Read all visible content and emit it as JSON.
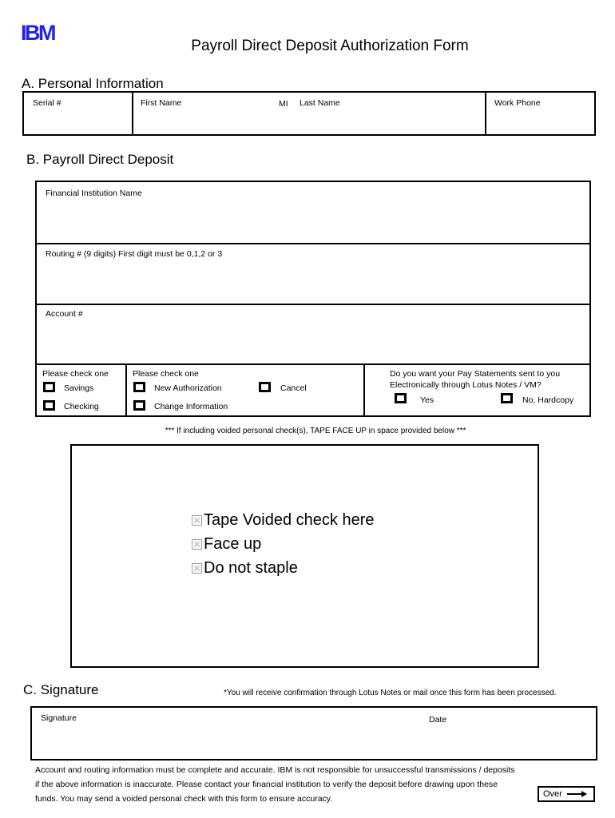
{
  "logo": {
    "text": "IBM",
    "color": "#2222ee"
  },
  "title": "Payroll Direct Deposit Authorization Form",
  "section_a": {
    "heading": "A. Personal Information",
    "fields": {
      "serial": "Serial #",
      "first_name": "First Name",
      "mi": "MI",
      "last_name": "Last Name",
      "work_phone": "Work Phone"
    }
  },
  "section_b": {
    "heading": "B. Payroll Direct Deposit",
    "fields": {
      "institution": "Financial Institution Name",
      "routing": "Routing # (9 digits) First digit must be 0,1,2 or 3",
      "account": "Account #"
    },
    "account_type": {
      "prompt": "Please check one",
      "options": [
        "Savings",
        "Checking"
      ]
    },
    "action_type": {
      "prompt": "Please check one",
      "options": [
        "New Authorization",
        "Cancel",
        "Change Information"
      ]
    },
    "pay_statements": {
      "prompt_line1": "Do you want your Pay Statements sent to you",
      "prompt_line2": "Electronically through Lotus Notes / VM?",
      "options": [
        "Yes",
        "No, Hardcopy"
      ]
    }
  },
  "tape_section": {
    "note": "*** If including voided personal check(s), TAPE FACE UP in space provided below ***",
    "items": [
      "Tape Voided check here",
      "Face up",
      "Do not staple"
    ],
    "bullet_icon": "broken-image-icon"
  },
  "section_c": {
    "heading": "C. Signature",
    "note": "*You will receive confirmation through Lotus Notes or mail once this form has been processed.",
    "fields": {
      "signature": "Signature",
      "date": "Date"
    }
  },
  "disclaimer": {
    "line1": "Account and routing information must be complete and accurate. IBM is not responsible for unsuccessful transmissions / deposits",
    "line2": "if the above information is inaccurate. Please contact your financial institution to verify the deposit before drawing upon these",
    "line3": "funds. You may send a voided personal check with this form to ensure accuracy."
  },
  "over_indicator": {
    "label": "Over",
    "arrow": "right-arrow-icon"
  }
}
